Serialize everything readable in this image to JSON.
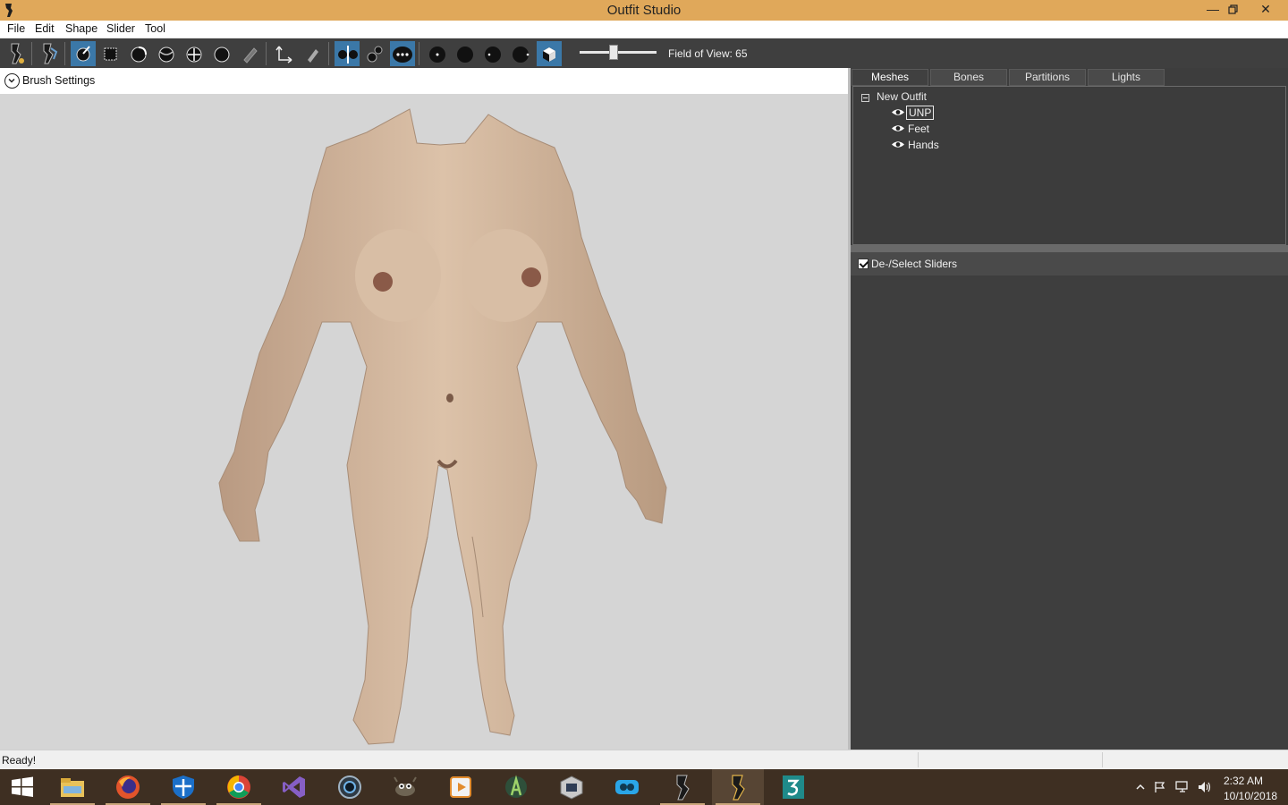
{
  "window": {
    "title": "Outfit Studio",
    "minimize_icon": "minimize-icon",
    "maximize_icon": "restore-icon",
    "close_icon": "close-icon",
    "titlebar_color": "#e0a85a"
  },
  "menu": {
    "items": [
      "File",
      "Edit",
      "Shape",
      "Slider",
      "Tool"
    ]
  },
  "toolbar": {
    "accent": "#3b78a8",
    "field_of_view_label": "Field of View: 65",
    "field_of_view_value": 65,
    "buttons": [
      {
        "name": "ref-shape-icon",
        "active": false
      },
      {
        "name": "outfit-shape-icon",
        "active": false
      },
      {
        "name": "select-brush-icon",
        "active": true
      },
      {
        "name": "mask-brush-icon",
        "active": false
      },
      {
        "name": "inflate-brush-icon",
        "active": false
      },
      {
        "name": "deflate-brush-icon",
        "active": false
      },
      {
        "name": "move-brush-icon",
        "active": false
      },
      {
        "name": "smooth-brush-icon",
        "active": false
      },
      {
        "name": "weight-brush-icon",
        "active": false
      },
      {
        "name": "transform-icon",
        "active": false
      },
      {
        "name": "pivot-pen-icon",
        "active": false
      },
      {
        "name": "mirror-x-icon",
        "active": true
      },
      {
        "name": "vertex-select-icon",
        "active": false
      },
      {
        "name": "connected-only-icon",
        "active": true
      },
      {
        "name": "brush-size-small-icon",
        "active": false
      },
      {
        "name": "brush-size-medium-icon",
        "active": false
      },
      {
        "name": "brush-size-large-icon",
        "active": false
      },
      {
        "name": "brush-size-xlarge-icon",
        "active": false
      },
      {
        "name": "cube-view-icon",
        "active": true
      }
    ]
  },
  "viewport": {
    "brush_settings_label": "Brush Settings",
    "toggle_icon": "chevron-down-circle-icon",
    "background": "#d5d5d5",
    "model_skin_color": "#d2b59b"
  },
  "right_panel": {
    "tabs": [
      "Meshes",
      "Bones",
      "Partitions",
      "Lights"
    ],
    "active_tab": "Meshes",
    "tree": {
      "root": "New Outfit",
      "items": [
        {
          "label": "UNP",
          "selected": true
        },
        {
          "label": "Feet",
          "selected": false
        },
        {
          "label": "Hands",
          "selected": false
        }
      ]
    },
    "sliders_header": "De-/Select Sliders",
    "sliders_checked": true
  },
  "status": {
    "text": "Ready!"
  },
  "taskbar": {
    "apps": [
      {
        "name": "start-icon",
        "running": false
      },
      {
        "name": "file-explorer-icon",
        "running": true
      },
      {
        "name": "firefox-icon",
        "running": true
      },
      {
        "name": "windows-defender-icon",
        "running": true
      },
      {
        "name": "chrome-icon",
        "running": true
      },
      {
        "name": "visual-studio-icon",
        "running": false
      },
      {
        "name": "webcam-icon",
        "running": false
      },
      {
        "name": "gimp-icon",
        "running": false
      },
      {
        "name": "media-player-icon",
        "running": false
      },
      {
        "name": "android-studio-icon",
        "running": false
      },
      {
        "name": "virtualbox-icon",
        "running": false
      },
      {
        "name": "loop-app-icon",
        "running": false
      },
      {
        "name": "outfit-studio-ref-icon",
        "running": true
      },
      {
        "name": "outfit-studio-icon",
        "running": true,
        "open": true
      },
      {
        "name": "3ds-max-icon",
        "running": false
      }
    ],
    "tray_icons": [
      "chevron-up-icon",
      "flag-icon",
      "network-icon",
      "volume-icon"
    ],
    "time": "2:32 AM",
    "date": "10/10/2018"
  }
}
